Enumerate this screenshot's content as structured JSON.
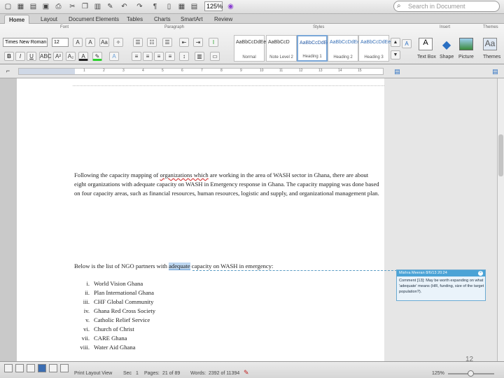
{
  "toolbar": {
    "zoom_value": "125%",
    "search_placeholder": "Search in Document"
  },
  "tabs": [
    "Home",
    "Layout",
    "Document Elements",
    "Tables",
    "Charts",
    "SmartArt",
    "Review"
  ],
  "ribbon": {
    "groups": {
      "font": "Font",
      "paragraph": "Paragraph",
      "styles": "Styles",
      "insert": "Insert",
      "themes": "Themes"
    },
    "font_name": "Times New Roman",
    "font_size": "12",
    "styles": [
      {
        "sample": "AaBbCcDdEe",
        "name": "Normal"
      },
      {
        "sample": "AaBbCcD",
        "name": "Note Level 2"
      },
      {
        "sample": "AaBbCcDdEe",
        "name": "Heading 1"
      },
      {
        "sample": "AaBbCcDdEe",
        "name": "Heading 2"
      },
      {
        "sample": "AaBbCcDdEe",
        "name": "Heading 3"
      }
    ],
    "insert": {
      "text_box": "Text Box",
      "shape": "Shape",
      "picture": "Picture",
      "themes": "Themes"
    }
  },
  "document": {
    "paragraph1": {
      "before_err": "Following the capacity mapping of ",
      "err1": "organizations which",
      "after_err": " are working in the area of WASH sector in Ghana, there are about",
      "line2": "eight organizations with adequate capacity on WASH in Emergency response in Ghana. The capacity mapping was done based",
      "line3": "on four capacity areas, such as financial resources, human resources, logistic and supply, and organizational management plan."
    },
    "paragraph2": {
      "before": "Below is the list of NGO partners with ",
      "highlight": "adequate",
      "after": " capacity on WASH in emergency:"
    },
    "list": [
      {
        "num": "i.",
        "text": "World Vision Ghana"
      },
      {
        "num": "ii.",
        "text": "Plan International Ghana"
      },
      {
        "num": "iii.",
        "text": "CHF Global Community"
      },
      {
        "num": "iv.",
        "text": "Ghana Red Cross Society"
      },
      {
        "num": "v.",
        "text": "Catholic Relief Service"
      },
      {
        "num": "vi.",
        "text": "Church of Christ"
      },
      {
        "num": "vii.",
        "text": "CARE Ghana"
      },
      {
        "num": "viii.",
        "text": "Water Aid Ghana"
      }
    ]
  },
  "comment": {
    "header": "Mishra Meeran 8/6/13 20:24",
    "body": "Comment [13]: May be worth expanding on what 'adequate' means (HR, funding, size of the target population?)."
  },
  "page_number": "12",
  "statusbar": {
    "view": "Print Layout View",
    "sec_label": "Sec",
    "sec_value": "1",
    "pages_label": "Pages:",
    "pages_value": "21 of 89",
    "words_label": "Words:",
    "words_value": "2392 of 11394",
    "zoom": "125%"
  }
}
